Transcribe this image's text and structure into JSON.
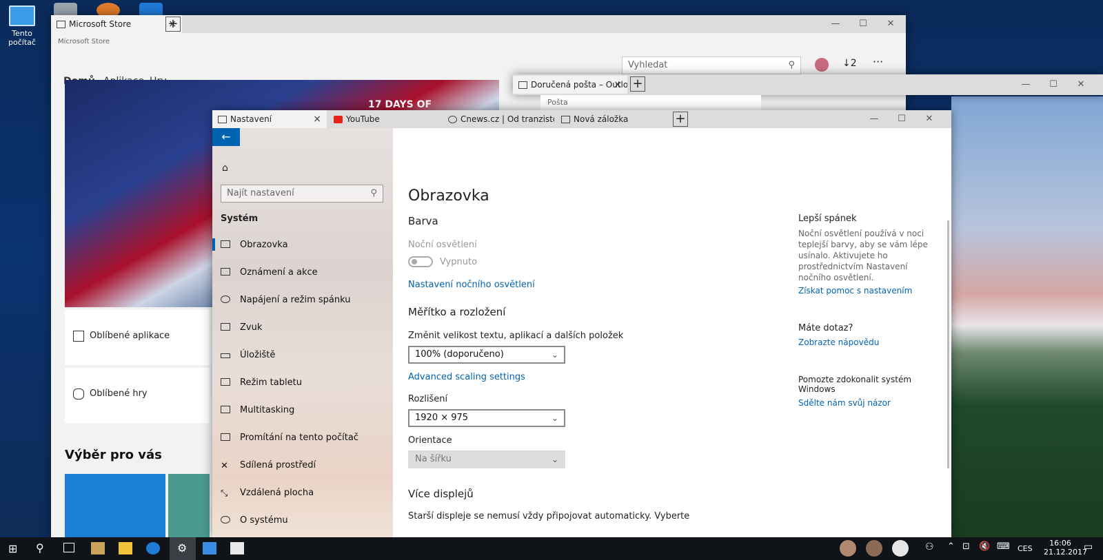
{
  "desktop": {
    "icon_label": "Tento počítač"
  },
  "store": {
    "tab_title": "Microsoft Store",
    "app_title": "Microsoft Store",
    "nav": [
      "Domů",
      "Aplikace",
      "Hry"
    ],
    "search_placeholder": "Vyhledat",
    "downloads": "2",
    "more": "···",
    "cards": [
      "Oblíbené aplikace",
      "Oblíbené hry"
    ],
    "section_title": "Výběr pro vás",
    "hero_text": "17 DAYS OF"
  },
  "mail": {
    "tab_title": "Doručená pošta – Outlo",
    "header": "Pošta"
  },
  "settings": {
    "tabs": [
      "Nastavení",
      "YouTube",
      "Cnews.cz | Od tranzistorů až",
      "Nová záložka"
    ],
    "search_placeholder": "Najít nastavení",
    "group": "Systém",
    "nav": [
      "Obrazovka",
      "Oznámení a akce",
      "Napájení a režim spánku",
      "Zvuk",
      "Úložiště",
      "Režim tabletu",
      "Multitasking",
      "Promítání na tento počítač",
      "Sdílená prostředí",
      "Vzdálená plocha",
      "O systému"
    ],
    "page_title": "Obrazovka",
    "color_heading": "Barva",
    "night_light_label": "Noční osvětlení",
    "night_light_state": "Vypnuto",
    "night_light_link": "Nastavení nočního osvětlení",
    "scale_heading": "Měřítko a rozložení",
    "scale_label": "Změnit velikost textu, aplikací a dalších položek",
    "scale_value": "100% (doporučeno)",
    "advanced_link": "Advanced scaling settings",
    "resolution_label": "Rozlišení",
    "resolution_value": "1920 × 975",
    "orientation_label": "Orientace",
    "orientation_value": "Na šířku",
    "multi_heading": "Více displejů",
    "multi_text": "Starší displeje se nemusí vždy připojovat automaticky. Vyberte",
    "side": {
      "sleep_title": "Lepší spánek",
      "sleep_text": "Noční osvětlení používá v noci teplejší barvy, aby se vám lépe usínalo. Aktivujete ho prostřednictvím Nastavení nočního osvětlení.",
      "sleep_link": "Získat pomoc s nastavením",
      "q_title": "Máte dotaz?",
      "q_link": "Zobrazte nápovědu",
      "improve_title": "Pomozte zdokonalit systém Windows",
      "improve_link": "Sdělte nám svůj názor"
    }
  },
  "taskbar": {
    "lang": "CES",
    "time": "16:06",
    "date": "21.12.2017"
  },
  "colors": {
    "accent": "#0063b1",
    "taskbar": "#101418"
  }
}
